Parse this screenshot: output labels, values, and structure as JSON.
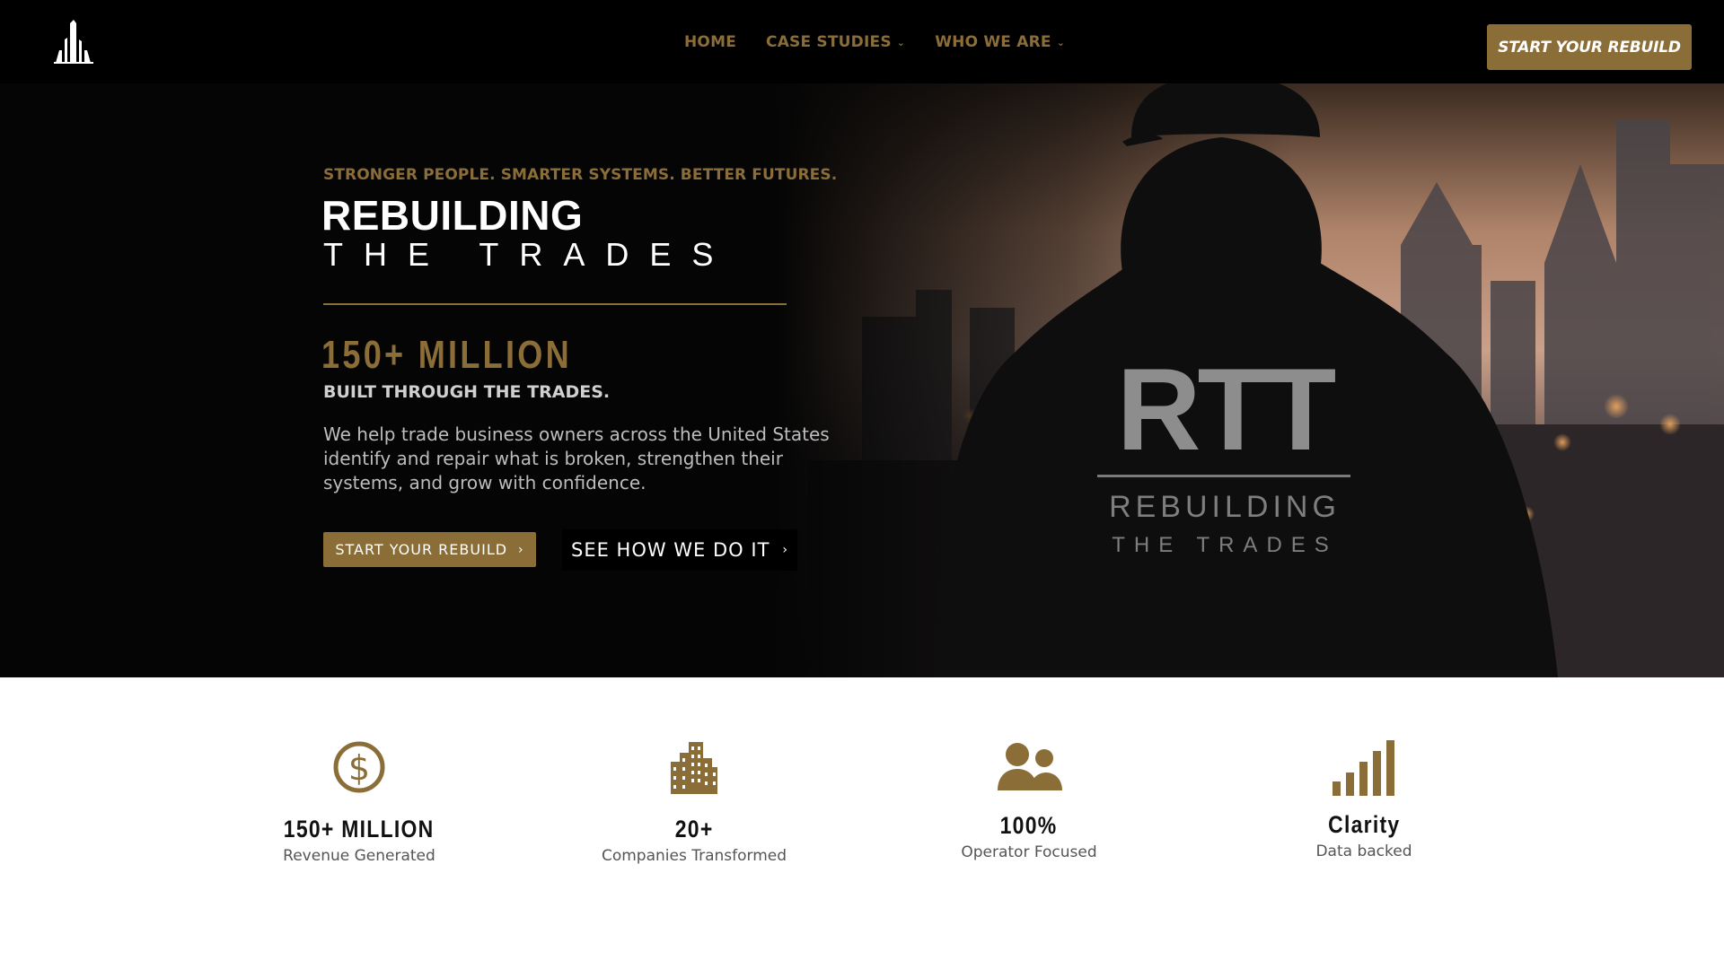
{
  "colors": {
    "brand_gold": "#8b6d38",
    "header_bg": "#000000",
    "hero_bg": "#050505",
    "body_text": "#bdbdbd"
  },
  "header": {
    "logo_icon": "skyline-logo-icon",
    "nav": [
      {
        "label": "HOME",
        "has_dropdown": false
      },
      {
        "label": "CASE STUDIES",
        "has_dropdown": true
      },
      {
        "label": "WHO WE ARE",
        "has_dropdown": true
      }
    ],
    "cta_label": "START YOUR REBUILD"
  },
  "hero": {
    "eyebrow": "STRONGER PEOPLE. SMARTER SYSTEMS. BETTER FUTURES.",
    "title_line1": "REBUILDING",
    "title_line2": "THE TRADES",
    "stat": "150+ MILLION",
    "stat_sub": "BUILT THROUGH THE TRADES.",
    "body": "We help trade business owners across the United States identify and  repair what is broken, strengthen their systems, and grow with confidence.",
    "primary_button": "START YOUR REBUILD",
    "secondary_button": "SEE HOW WE DO IT",
    "hoodie_logo": "RTT",
    "hoodie_line1": "REBUILDING",
    "hoodie_line2": "THE TRADES"
  },
  "stats": [
    {
      "icon": "dollar-coin-icon",
      "value": "150+ MILLION",
      "label": "Revenue Generated"
    },
    {
      "icon": "buildings-icon",
      "value": "20+",
      "label": "Companies Transformed"
    },
    {
      "icon": "people-icon",
      "value": "100%",
      "label": "Operator Focused"
    },
    {
      "icon": "bar-chart-icon",
      "value": "Clarity",
      "label": "Data backed"
    }
  ]
}
